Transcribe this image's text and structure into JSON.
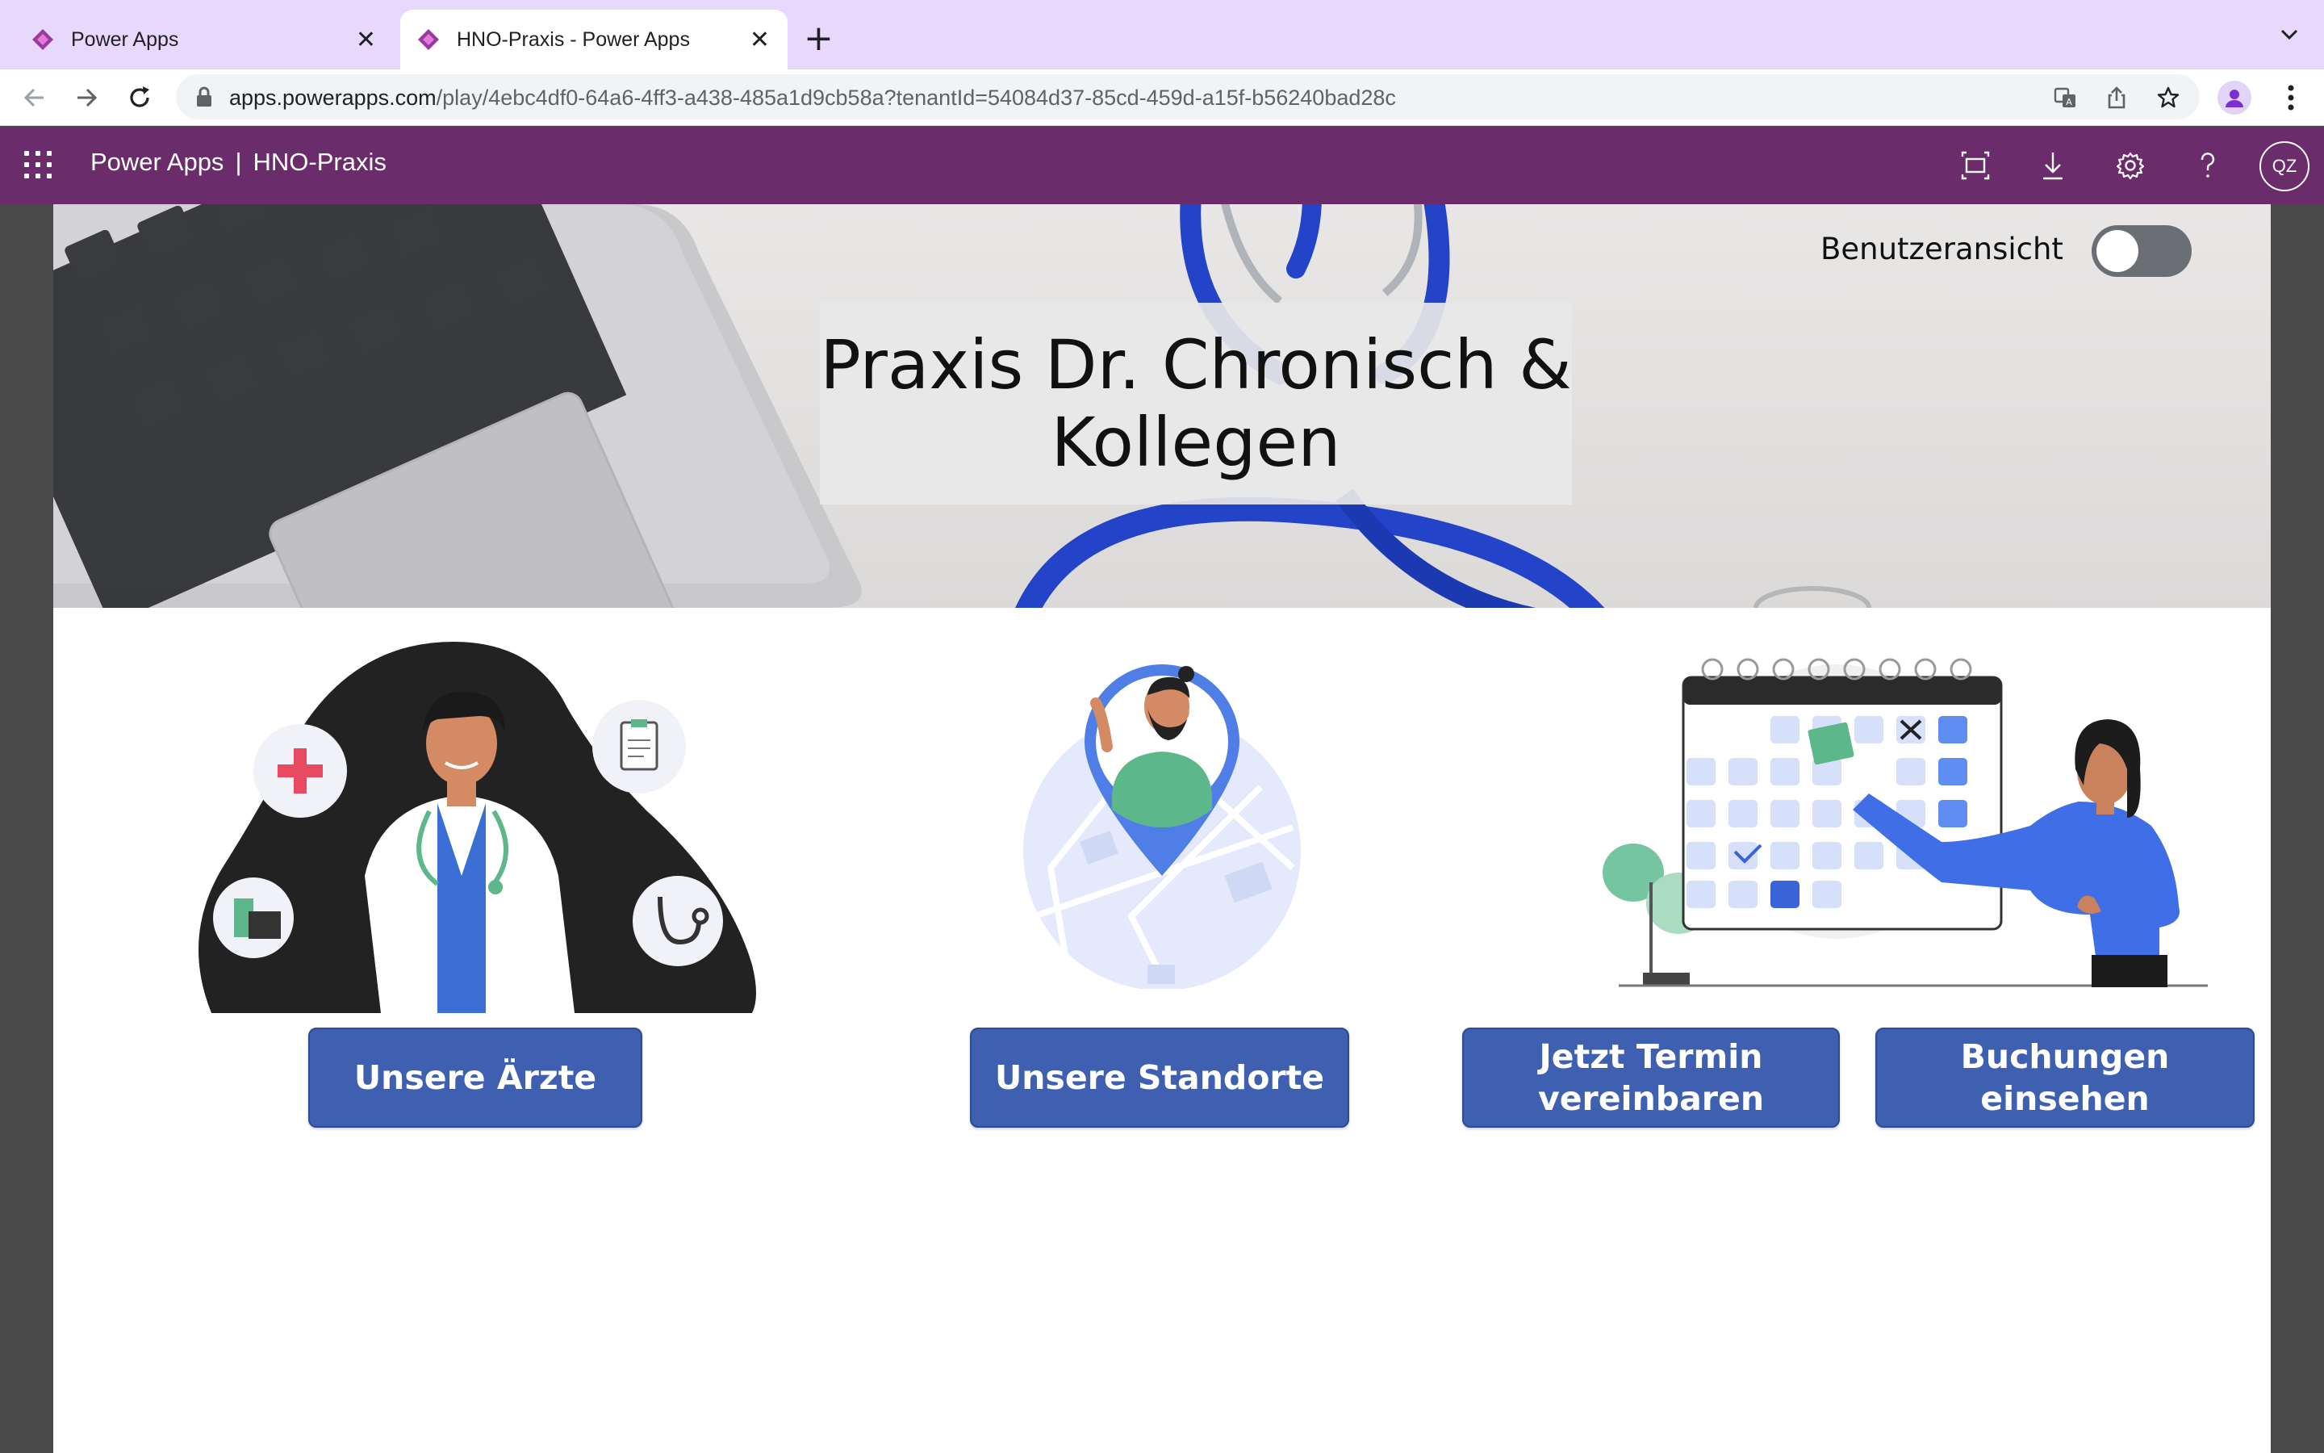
{
  "browser": {
    "tabs": [
      {
        "title": "Power Apps",
        "active": false
      },
      {
        "title": "HNO-Praxis - Power Apps",
        "active": true
      }
    ],
    "url_host": "apps.powerapps.com",
    "url_path": "/play/4ebc4df0-64a6-4ff3-a438-485a1d9cb58a?tenantId=54084d37-85cd-459d-a15f-b56240bad28c",
    "colors": {
      "tabstrip": "#e8d8fb",
      "toolbar": "#ffffff"
    }
  },
  "header": {
    "product": "Power Apps",
    "separator": "|",
    "app_name": "HNO-Praxis",
    "avatar_initials": "QZ",
    "icons": [
      "waffle-icon",
      "fit-to-screen-icon",
      "download-icon",
      "settings-icon",
      "help-icon"
    ],
    "color": "#6b2c6c"
  },
  "hero": {
    "title": "Praxis Dr. Chronisch & Kollegen",
    "toggle_label": "Benutzeransicht",
    "toggle_on": false
  },
  "actions": [
    {
      "label": "Unsere Ärzte"
    },
    {
      "label": "Unsere Standorte"
    },
    {
      "label": "Jetzt Termin vereinbaren"
    },
    {
      "label": "Buchungen einsehen"
    }
  ],
  "button_color": "#3f5fb0"
}
